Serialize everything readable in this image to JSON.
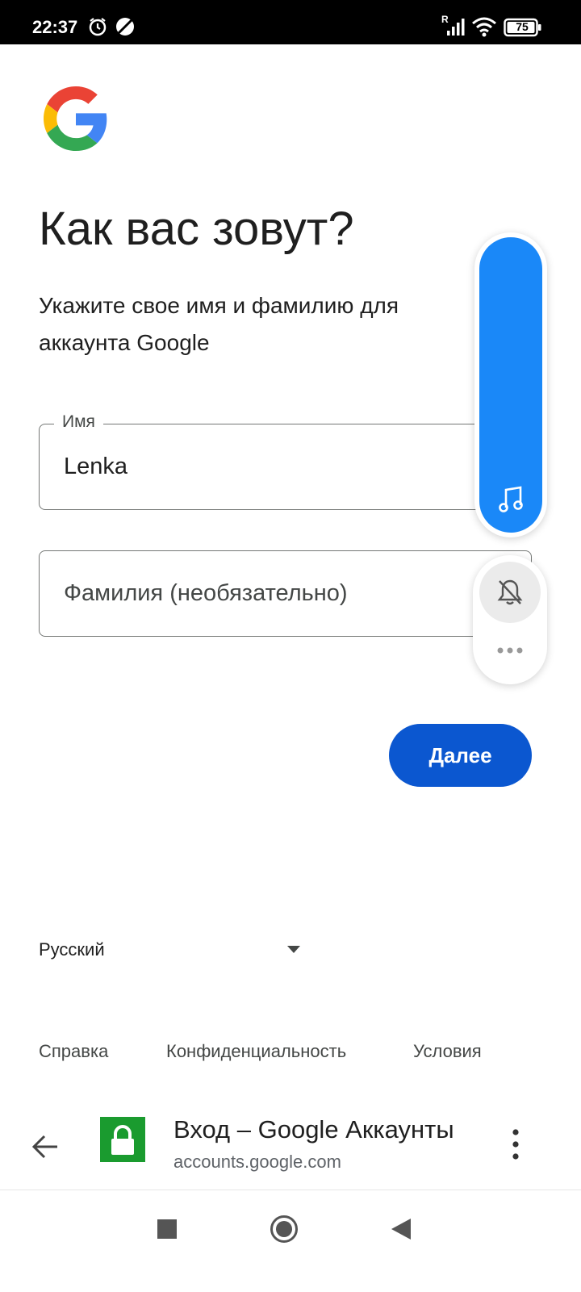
{
  "status_bar": {
    "time": "22:37",
    "battery": "75",
    "signal_tag": "R",
    "icons": [
      "alarm-icon",
      "mute-moon-icon",
      "signal-icon",
      "wifi-icon",
      "battery-icon"
    ]
  },
  "brand": {
    "logo_icon": "google-g-logo"
  },
  "page": {
    "title": "Как вас зовут?",
    "subtitle": "Укажите свое имя и фамилию для аккаунта Google"
  },
  "form": {
    "first_name": {
      "label": "Имя",
      "value": "Lenka"
    },
    "last_name": {
      "placeholder": "Фамилия (необязательно)"
    },
    "next_button": "Далее"
  },
  "language": {
    "selected": "Русский"
  },
  "footer": {
    "links": [
      "Справка",
      "Конфиденциальность",
      "Условия"
    ]
  },
  "browser": {
    "page_title": "Вход – Google Аккаунты",
    "url": "accounts.google.com"
  },
  "floating_controls": {
    "icons": [
      "music-note-icon",
      "bell-off-icon",
      "more-horizontal-icon"
    ]
  },
  "colors": {
    "primary_button": "#0b57d0",
    "float_bar": "#1a88f8",
    "lock_green": "#1a9b2f"
  }
}
